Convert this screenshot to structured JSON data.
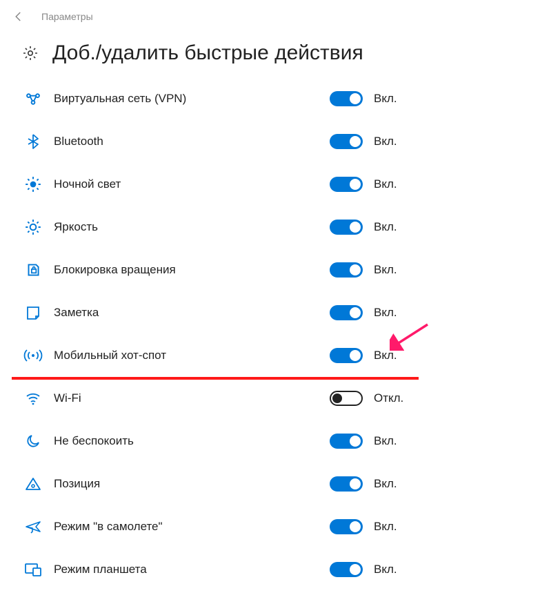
{
  "header": {
    "breadcrumb": "Параметры"
  },
  "page_title": "Доб./удалить быстрые действия",
  "states": {
    "on": "Вкл.",
    "off": "Откл."
  },
  "settings": [
    {
      "key": "vpn",
      "label": "Виртуальная сеть (VPN)",
      "on": true,
      "highlight": false
    },
    {
      "key": "bluetooth",
      "label": "Bluetooth",
      "on": true,
      "highlight": false
    },
    {
      "key": "nightlight",
      "label": "Ночной свет",
      "on": true,
      "highlight": false
    },
    {
      "key": "brightness",
      "label": "Яркость",
      "on": true,
      "highlight": false
    },
    {
      "key": "rotlock",
      "label": "Блокировка вращения",
      "on": true,
      "highlight": false
    },
    {
      "key": "note",
      "label": "Заметка",
      "on": true,
      "highlight": false
    },
    {
      "key": "hotspot",
      "label": "Мобильный хот-спот",
      "on": true,
      "highlight": true
    },
    {
      "key": "wifi",
      "label": "Wi-Fi",
      "on": false,
      "highlight": false
    },
    {
      "key": "dnd",
      "label": "Не беспокоить",
      "on": true,
      "highlight": false
    },
    {
      "key": "location",
      "label": "Позиция",
      "on": true,
      "highlight": false
    },
    {
      "key": "airplane",
      "label": "Режим \"в самолете\"",
      "on": true,
      "highlight": false
    },
    {
      "key": "tablet",
      "label": "Режим планшета",
      "on": true,
      "highlight": false
    }
  ],
  "icon_color": "#0078d7"
}
